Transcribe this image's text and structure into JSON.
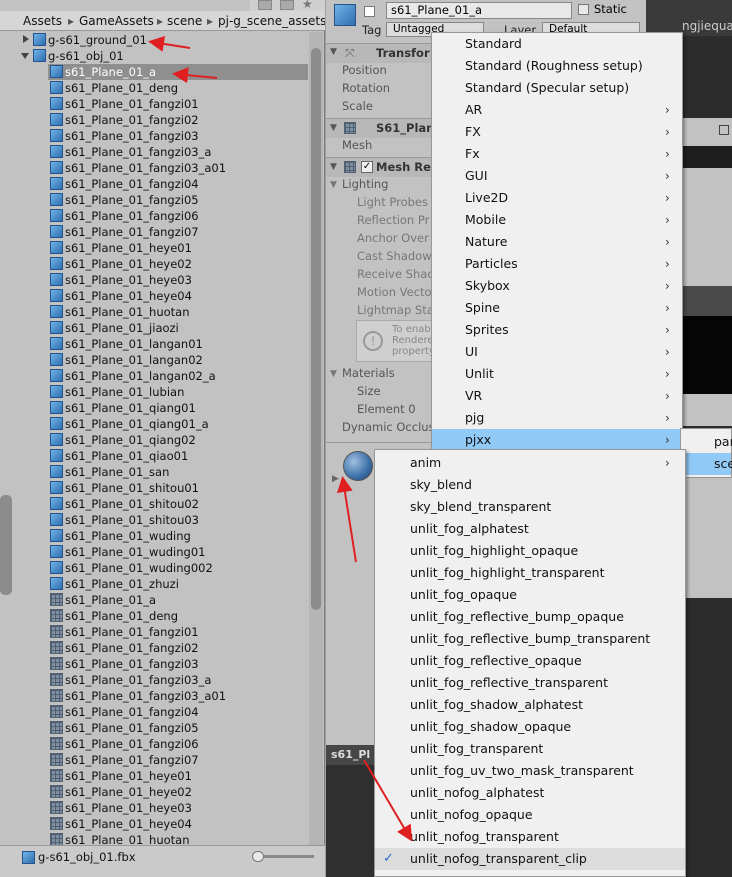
{
  "project": {
    "breadcrumbs": [
      "Assets",
      "GameAssets",
      "scene",
      "pj-g_scene_assets"
    ],
    "breadcrumb_sep": "▸",
    "tree": [
      {
        "label": "g-s61_ground_01",
        "icon": "prefab",
        "fold": "collapsed"
      },
      {
        "label": "g-s61_obj_01",
        "icon": "prefab",
        "fold": "expanded"
      },
      {
        "label": "s61_Plane_01_a",
        "icon": "prefab",
        "selected": true
      },
      {
        "label": "s61_Plane_01_deng",
        "icon": "prefab"
      },
      {
        "label": "s61_Plane_01_fangzi01",
        "icon": "prefab"
      },
      {
        "label": "s61_Plane_01_fangzi02",
        "icon": "prefab"
      },
      {
        "label": "s61_Plane_01_fangzi03",
        "icon": "prefab"
      },
      {
        "label": "s61_Plane_01_fangzi03_a",
        "icon": "prefab"
      },
      {
        "label": "s61_Plane_01_fangzi03_a01",
        "icon": "prefab"
      },
      {
        "label": "s61_Plane_01_fangzi04",
        "icon": "prefab"
      },
      {
        "label": "s61_Plane_01_fangzi05",
        "icon": "prefab"
      },
      {
        "label": "s61_Plane_01_fangzi06",
        "icon": "prefab"
      },
      {
        "label": "s61_Plane_01_fangzi07",
        "icon": "prefab"
      },
      {
        "label": "s61_Plane_01_heye01",
        "icon": "prefab"
      },
      {
        "label": "s61_Plane_01_heye02",
        "icon": "prefab"
      },
      {
        "label": "s61_Plane_01_heye03",
        "icon": "prefab"
      },
      {
        "label": "s61_Plane_01_heye04",
        "icon": "prefab"
      },
      {
        "label": "s61_Plane_01_huotan",
        "icon": "prefab"
      },
      {
        "label": "s61_Plane_01_jiaozi",
        "icon": "prefab"
      },
      {
        "label": "s61_Plane_01_langan01",
        "icon": "prefab"
      },
      {
        "label": "s61_Plane_01_langan02",
        "icon": "prefab"
      },
      {
        "label": "s61_Plane_01_langan02_a",
        "icon": "prefab"
      },
      {
        "label": "s61_Plane_01_lubian",
        "icon": "prefab"
      },
      {
        "label": "s61_Plane_01_qiang01",
        "icon": "prefab"
      },
      {
        "label": "s61_Plane_01_qiang01_a",
        "icon": "prefab"
      },
      {
        "label": "s61_Plane_01_qiang02",
        "icon": "prefab"
      },
      {
        "label": "s61_Plane_01_qiao01",
        "icon": "prefab"
      },
      {
        "label": "s61_Plane_01_san",
        "icon": "prefab"
      },
      {
        "label": "s61_Plane_01_shitou01",
        "icon": "prefab"
      },
      {
        "label": "s61_Plane_01_shitou02",
        "icon": "prefab"
      },
      {
        "label": "s61_Plane_01_shitou03",
        "icon": "prefab"
      },
      {
        "label": "s61_Plane_01_wuding",
        "icon": "prefab"
      },
      {
        "label": "s61_Plane_01_wuding01",
        "icon": "prefab"
      },
      {
        "label": "s61_Plane_01_wuding002",
        "icon": "prefab"
      },
      {
        "label": "s61_Plane_01_zhuzi",
        "icon": "prefab"
      },
      {
        "label": "s61_Plane_01_a",
        "icon": "mesh"
      },
      {
        "label": "s61_Plane_01_deng",
        "icon": "mesh"
      },
      {
        "label": "s61_Plane_01_fangzi01",
        "icon": "mesh"
      },
      {
        "label": "s61_Plane_01_fangzi02",
        "icon": "mesh"
      },
      {
        "label": "s61_Plane_01_fangzi03",
        "icon": "mesh"
      },
      {
        "label": "s61_Plane_01_fangzi03_a",
        "icon": "mesh"
      },
      {
        "label": "s61_Plane_01_fangzi03_a01",
        "icon": "mesh"
      },
      {
        "label": "s61_Plane_01_fangzi04",
        "icon": "mesh"
      },
      {
        "label": "s61_Plane_01_fangzi05",
        "icon": "mesh"
      },
      {
        "label": "s61_Plane_01_fangzi06",
        "icon": "mesh"
      },
      {
        "label": "s61_Plane_01_fangzi07",
        "icon": "mesh"
      },
      {
        "label": "s61_Plane_01_heye01",
        "icon": "mesh"
      },
      {
        "label": "s61_Plane_01_heye02",
        "icon": "mesh"
      },
      {
        "label": "s61_Plane_01_heye03",
        "icon": "mesh"
      },
      {
        "label": "s61_Plane_01_heye04",
        "icon": "mesh"
      },
      {
        "label": "s61_Plane_01_huotan",
        "icon": "mesh"
      }
    ],
    "status_file": "g-s61_obj_01.fbx"
  },
  "inspector": {
    "object_name": "s61_Plane_01_a",
    "static_label": "Static",
    "tag_label": "Tag",
    "tag_value": "Untagged",
    "layer_label": "Layer",
    "layer_value": "Default",
    "transform_header": "Transfor",
    "position_label": "Position",
    "rotation_label": "Rotation",
    "scale_label": "Scale",
    "meshfilter_header": "S61_Plan",
    "mesh_label": "Mesh",
    "meshrenderer_header": "Mesh Re",
    "lighting_label": "Lighting",
    "light_probes_label": "Light Probes",
    "reflection_label": "Reflection Pr",
    "anchor_label": "Anchor Over",
    "cast_shadows_label": "Cast Shadow",
    "receive_shadows_label": "Receive Shad",
    "motion_vectors_label": "Motion Vecto",
    "lightmap_label": "Lightmap Sta",
    "info_line1": "To enab",
    "info_line2": "Rendere",
    "info_line3": "property",
    "materials_label": "Materials",
    "size_label": "Size",
    "element0_label": "Element 0",
    "dynamic_label": "Dynamic Occlus",
    "bottom_header": "s61_Pl"
  },
  "right_panel": {
    "text_top": "ngjiequan"
  },
  "shader_menu": [
    {
      "label": "Standard",
      "submenu": false
    },
    {
      "label": "Standard (Roughness setup)",
      "submenu": false
    },
    {
      "label": "Standard (Specular setup)",
      "submenu": false
    },
    {
      "label": "AR",
      "submenu": true
    },
    {
      "label": "FX",
      "submenu": true
    },
    {
      "label": "Fx",
      "submenu": true
    },
    {
      "label": "GUI",
      "submenu": true
    },
    {
      "label": "Live2D",
      "submenu": true
    },
    {
      "label": "Mobile",
      "submenu": true
    },
    {
      "label": "Nature",
      "submenu": true
    },
    {
      "label": "Particles",
      "submenu": true
    },
    {
      "label": "Skybox",
      "submenu": true
    },
    {
      "label": "Spine",
      "submenu": true
    },
    {
      "label": "Sprites",
      "submenu": true
    },
    {
      "label": "UI",
      "submenu": true
    },
    {
      "label": "Unlit",
      "submenu": true
    },
    {
      "label": "VR",
      "submenu": true
    },
    {
      "label": "pjg",
      "submenu": true
    },
    {
      "label": "pjxx",
      "submenu": true,
      "highlighted": true
    }
  ],
  "pjxx_menu": [
    {
      "label": "par"
    },
    {
      "label": "sce",
      "highlighted": true
    }
  ],
  "scene_menu": [
    {
      "label": "anim",
      "submenu": true
    },
    {
      "label": "sky_blend"
    },
    {
      "label": "sky_blend_transparent"
    },
    {
      "label": "unlit_fog_alphatest"
    },
    {
      "label": "unlit_fog_highlight_opaque"
    },
    {
      "label": "unlit_fog_highlight_transparent"
    },
    {
      "label": "unlit_fog_opaque"
    },
    {
      "label": "unlit_fog_reflective_bump_opaque"
    },
    {
      "label": "unlit_fog_reflective_bump_transparent"
    },
    {
      "label": "unlit_fog_reflective_opaque"
    },
    {
      "label": "unlit_fog_reflective_transparent"
    },
    {
      "label": "unlit_fog_shadow_alphatest"
    },
    {
      "label": "unlit_fog_shadow_opaque"
    },
    {
      "label": "unlit_fog_transparent"
    },
    {
      "label": "unlit_fog_uv_two_mask_transparent"
    },
    {
      "label": "unlit_nofog_alphatest"
    },
    {
      "label": "unlit_nofog_opaque"
    },
    {
      "label": "unlit_nofog_transparent"
    },
    {
      "label": "unlit_nofog_transparent_clip",
      "checked": true
    }
  ],
  "colors": {
    "highlight": "#91c9f7",
    "arrow_red": "#e02020",
    "selection": "#8f8f8f"
  }
}
